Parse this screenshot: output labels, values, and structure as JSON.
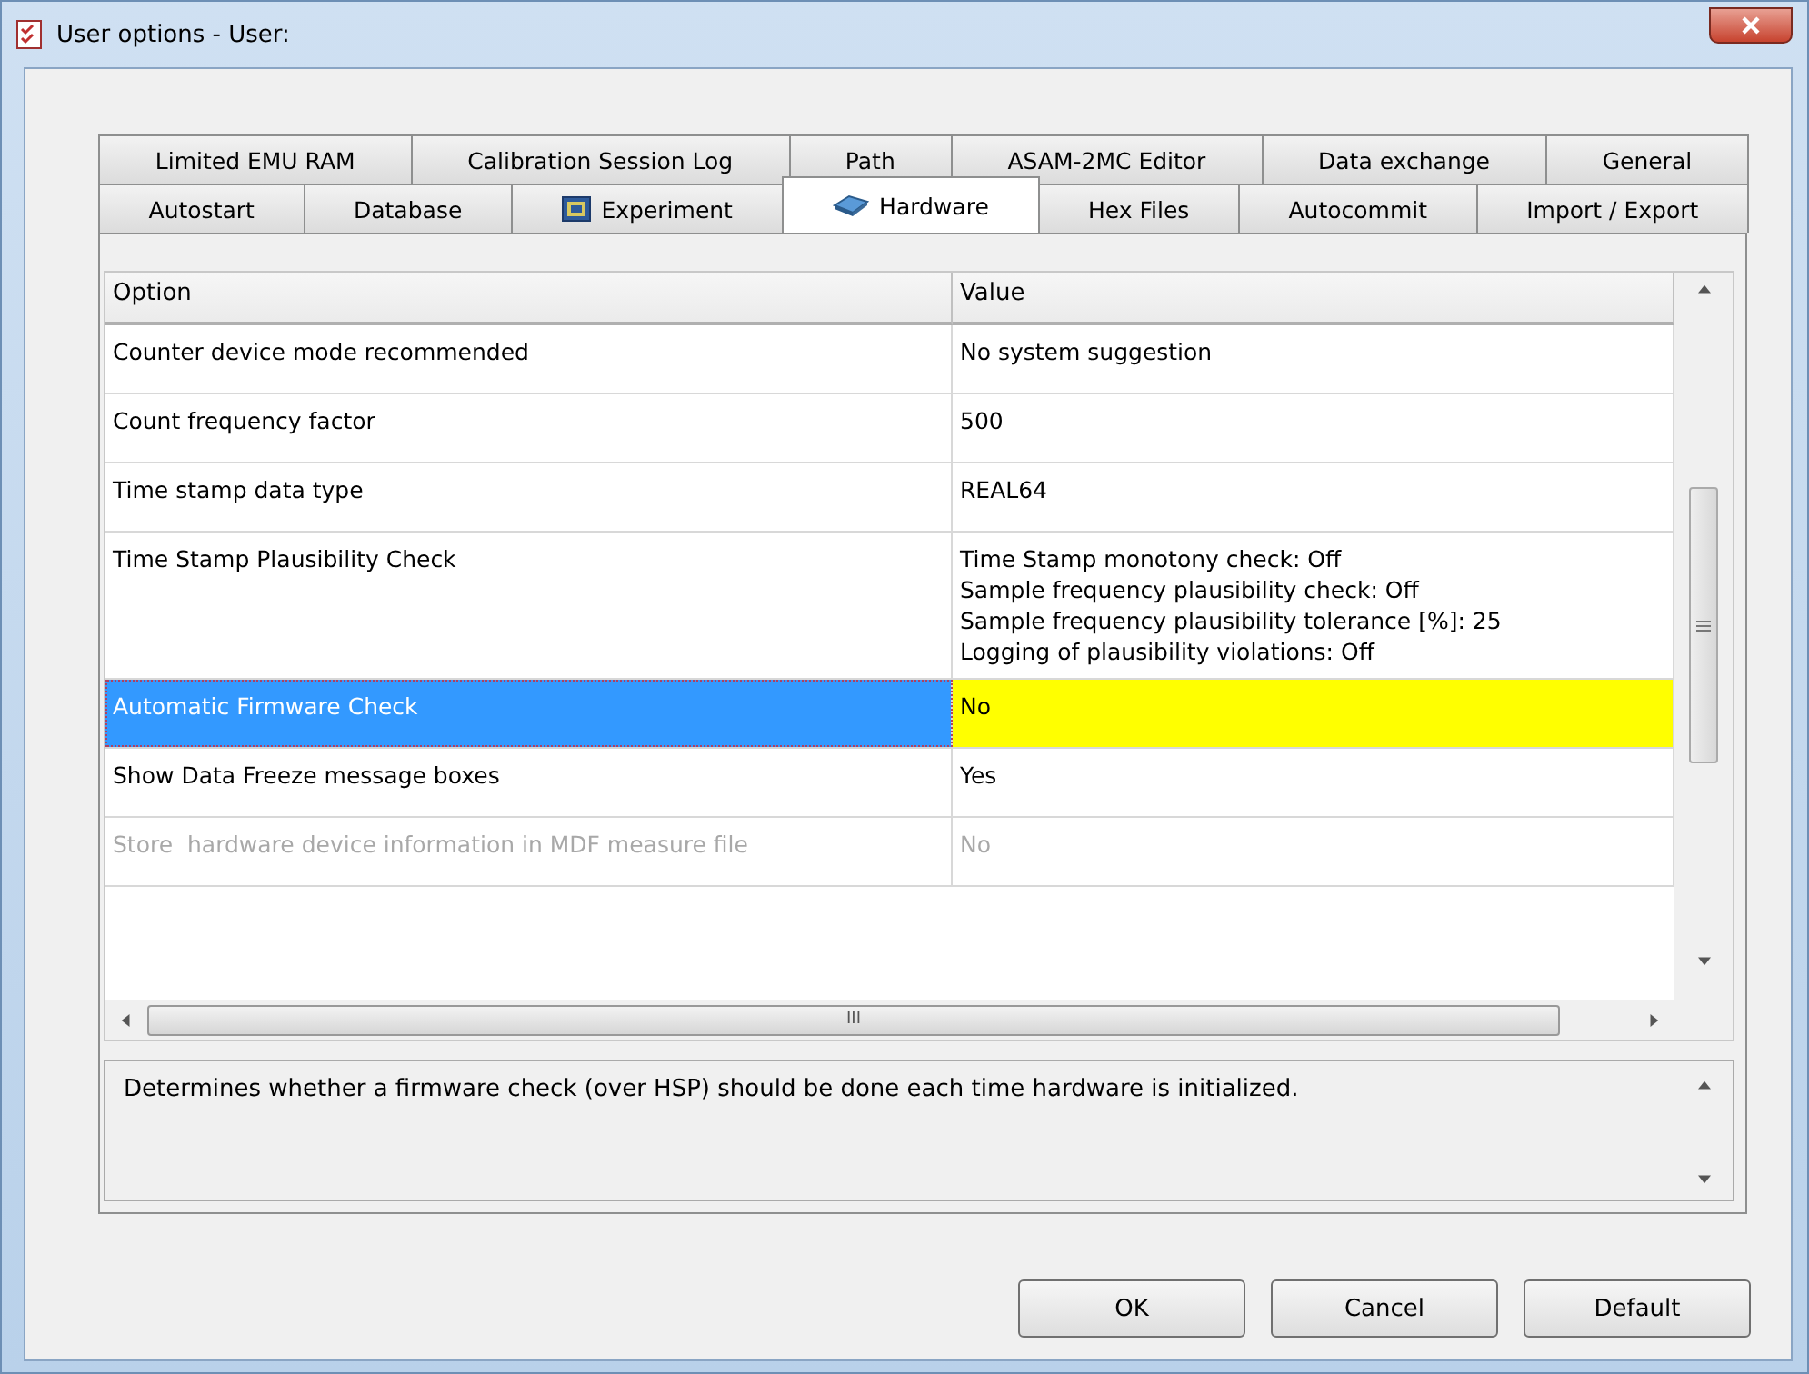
{
  "window": {
    "title": "User options - User:"
  },
  "tab_rows": [
    {
      "tabs": [
        {
          "label": "Limited EMU RAM",
          "selected": false
        },
        {
          "label": "Calibration Session Log",
          "selected": false
        },
        {
          "label": "Path",
          "selected": false
        },
        {
          "label": "ASAM-2MC Editor",
          "selected": false
        },
        {
          "label": "Data exchange",
          "selected": false
        },
        {
          "label": "General",
          "selected": false
        }
      ]
    },
    {
      "tabs": [
        {
          "label": "Autostart",
          "selected": false
        },
        {
          "label": "Database",
          "selected": false
        },
        {
          "label": "Experiment",
          "selected": false
        },
        {
          "label": "Hardware",
          "selected": true
        },
        {
          "label": "Hex Files",
          "selected": false
        },
        {
          "label": "Autocommit",
          "selected": false
        },
        {
          "label": "Import / Export",
          "selected": false
        }
      ]
    }
  ],
  "table": {
    "columns": [
      "Option",
      "Value"
    ],
    "rows": [
      {
        "option": "Counter device mode recommended",
        "value": [
          "No system suggestion"
        ],
        "selected": false,
        "disabled": false
      },
      {
        "option": "Count frequency factor",
        "value": [
          "500"
        ],
        "selected": false,
        "disabled": false
      },
      {
        "option": "Time stamp data type",
        "value": [
          "REAL64"
        ],
        "selected": false,
        "disabled": false
      },
      {
        "option": "Time Stamp Plausibility Check",
        "value": [
          "Time Stamp monotony check: Off",
          "Sample frequency plausibility check: Off",
          "Sample frequency plausibility tolerance [%]: 25",
          "Logging of plausibility violations: Off"
        ],
        "selected": false,
        "disabled": false
      },
      {
        "option": "Automatic Firmware Check",
        "value": [
          "No"
        ],
        "selected": true,
        "disabled": false
      },
      {
        "option": "Show Data Freeze message boxes",
        "value": [
          "Yes"
        ],
        "selected": false,
        "disabled": false
      },
      {
        "option": "Store  hardware device information in MDF measure file",
        "value": [
          "No"
        ],
        "selected": false,
        "disabled": true
      }
    ],
    "hscroll_grip": "III"
  },
  "description": "Determines whether a firmware check (over HSP) should be done each time hardware is initialized.",
  "buttons": [
    "OK",
    "Cancel",
    "Default"
  ]
}
